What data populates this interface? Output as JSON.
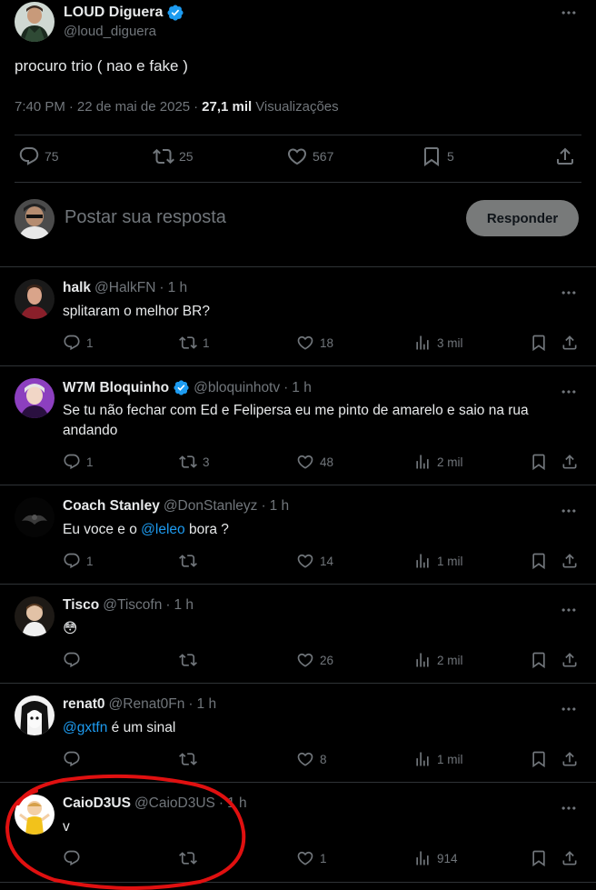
{
  "main_tweet": {
    "author_name": "LOUD Diguera",
    "author_handle": "@loud_diguera",
    "text": "procuro trio ( nao e fake )",
    "time": "7:40 PM",
    "date": "22 de mai de 2025",
    "views_count": "27,1 mil",
    "views_label": "Visualizações",
    "stats": {
      "replies": "75",
      "reposts": "25",
      "likes": "567",
      "bookmarks": "5"
    }
  },
  "composer": {
    "placeholder": "Postar sua resposta",
    "button_label": "Responder"
  },
  "replies": [
    {
      "name": "halk",
      "handle": "@HalkFN",
      "time": "1 h",
      "verified": false,
      "text": "splitaram o melhor BR?",
      "replies": "1",
      "reposts": "1",
      "likes": "18",
      "views": "3 mil"
    },
    {
      "name": "W7M Bloquinho",
      "handle": "@bloquinhotv",
      "time": "1 h",
      "verified": true,
      "text": "Se tu não fechar com Ed e Felipersa eu me pinto de amarelo e saio na rua andando",
      "replies": "1",
      "reposts": "3",
      "likes": "48",
      "views": "2 mil"
    },
    {
      "name": "Coach Stanley",
      "handle": "@DonStanleyz",
      "time": "1 h",
      "verified": false,
      "text_before": "Eu voce e o ",
      "mention": "@leleo",
      "text_after": " bora ?",
      "replies": "1",
      "reposts": "",
      "likes": "14",
      "views": "1 mil"
    },
    {
      "name": "Tisco",
      "handle": "@Tiscofn",
      "time": "1 h",
      "verified": false,
      "emoji": "😳",
      "replies": "",
      "reposts": "",
      "likes": "26",
      "views": "2 mil"
    },
    {
      "name": "renat0",
      "handle": "@Renat0Fn",
      "time": "1 h",
      "verified": false,
      "mention": "@gxtfn",
      "text_after": " é um sinal",
      "replies": "",
      "reposts": "",
      "likes": "8",
      "views": "1 mil"
    },
    {
      "name": "CaioD3US",
      "handle": "@CaioD3US",
      "time": "1 h",
      "verified": false,
      "text": "v",
      "replies": "",
      "reposts": "",
      "likes": "1",
      "views": "914"
    }
  ],
  "separator": "·",
  "colors": {
    "background": "#000000",
    "text": "#e7e9ea",
    "muted": "#71767b",
    "link": "#1d9bf0",
    "verified": "#1d9bf0",
    "border": "#2f3336",
    "annotation": "#e01010"
  },
  "icons": [
    "verified-badge-icon",
    "more-icon",
    "reply-icon",
    "repost-icon",
    "like-icon",
    "bookmark-icon",
    "share-icon",
    "views-icon"
  ]
}
